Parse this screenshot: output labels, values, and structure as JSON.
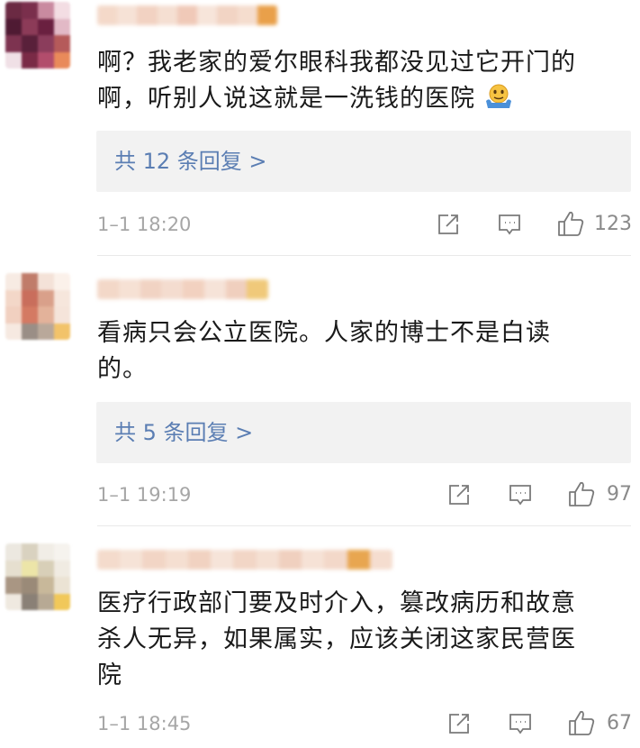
{
  "comments": [
    {
      "text_lines": [
        "啊？我老家的爱尔眼科我都没见过它开门的",
        "啊，听别人说这就是一洗钱的医院"
      ],
      "emoji": "shrug-emoji",
      "reply_label": "共 12 条回复 >",
      "time": "1–1 18:20",
      "likes": "123"
    },
    {
      "text_lines": [
        "看病只会公立医院。人家的博士不是白读",
        "的。"
      ],
      "reply_label": "共 5 条回复 >",
      "time": "1–1 19:19",
      "likes": "97"
    },
    {
      "text_lines": [
        "医疗行政部门要及时介入，篡改病历和故意",
        "杀人无异，如果属实，应该关闭这家民营医",
        "院"
      ],
      "time": "1–1 18:45",
      "likes": "67"
    }
  ],
  "icons": [
    "share-icon",
    "comment-icon",
    "like-icon"
  ],
  "colors": {
    "reply_link": "#5b7eb3",
    "meta_gray": "#a6a6a6",
    "reply_bg": "#f2f2f2"
  }
}
